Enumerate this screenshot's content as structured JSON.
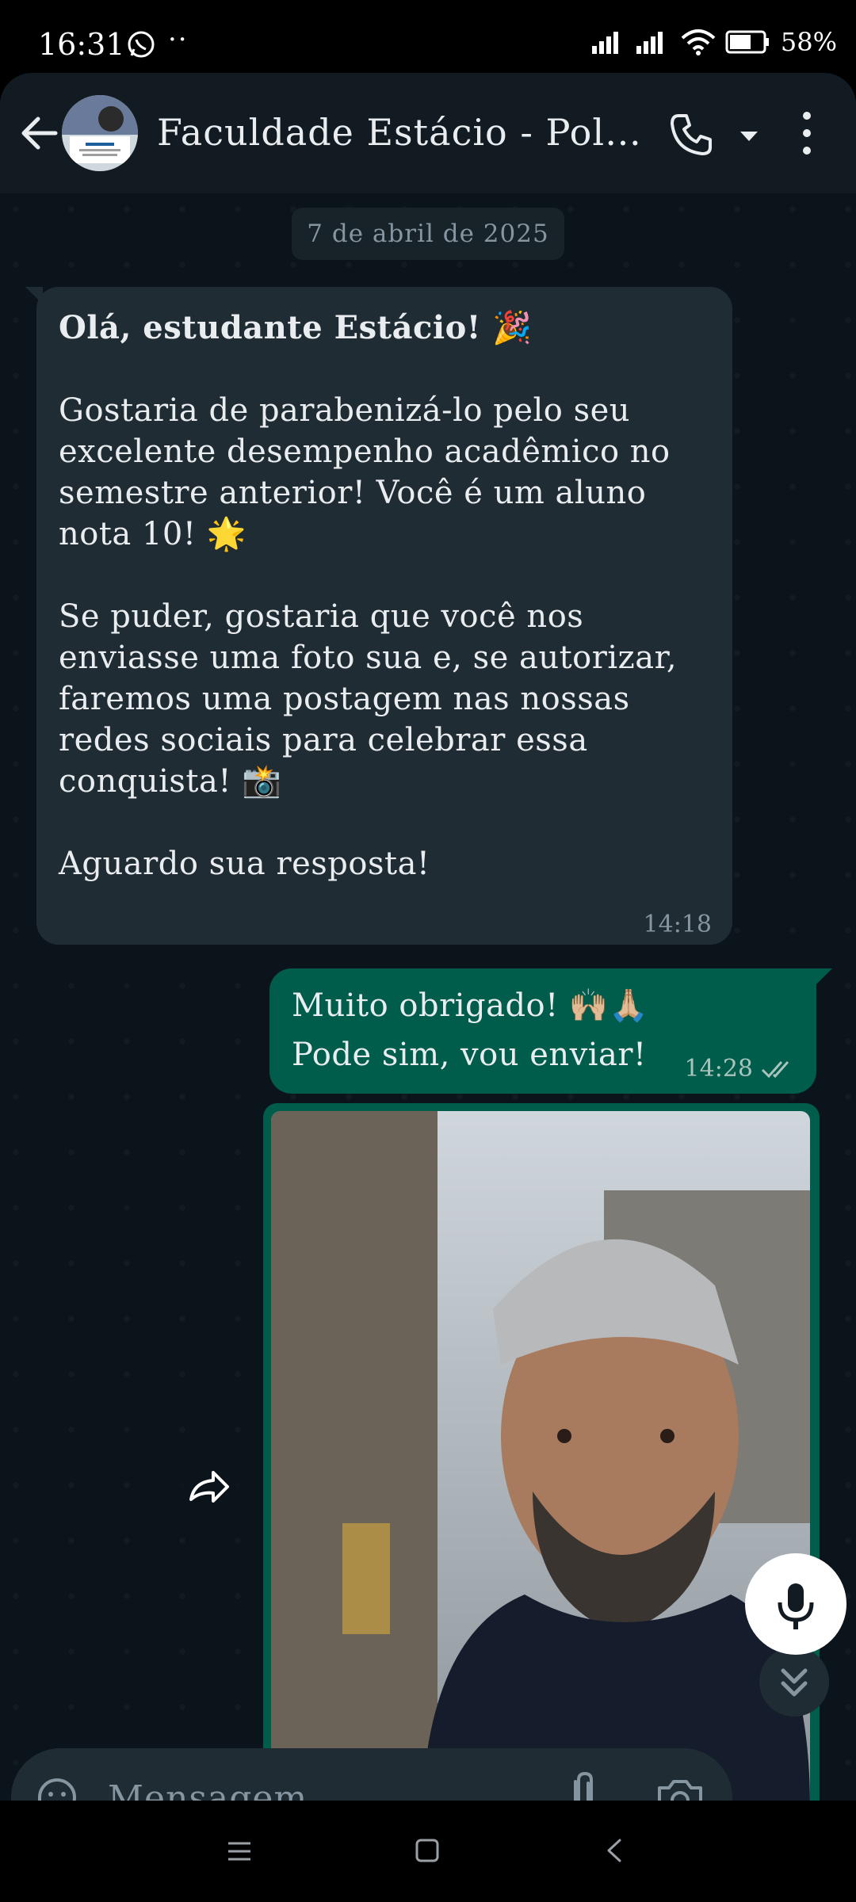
{
  "status_bar": {
    "time": "16:31",
    "battery": "58%"
  },
  "header": {
    "title": "Faculdade Estácio - Polo..."
  },
  "chat": {
    "date": "7 de abril de 2025",
    "incoming": {
      "greeting": "Olá, estudante Estácio! 🎉",
      "para1": "Gostaria de parabenizá-lo pelo seu excelente desempenho acadêmico no semestre anterior! Você é um aluno nota 10! 🌟",
      "para2": "Se puder, gostaria que você nos enviasse uma foto sua e, se autorizar, faremos uma postagem nas nossas redes sociais para celebrar essa conquista! 📸",
      "para3": "Aguardo sua resposta!",
      "time": "14:18"
    },
    "outgoing": {
      "line1": "Muito obrigado! 🙌🏼🙏🏼",
      "line2": "Pode sim, vou enviar!",
      "time": "14:28"
    }
  },
  "input": {
    "placeholder": "Mensagem"
  },
  "colors": {
    "header_bg": "#111b21",
    "chat_bg": "#0b141a",
    "incoming_bubble": "#202c33",
    "outgoing_bubble": "#005c4b",
    "read_tick": "#a8c4bd"
  },
  "icons": [
    "whatsapp-icon",
    "signal-icon",
    "wifi-icon",
    "battery-icon",
    "back-arrow-icon",
    "phone-icon",
    "chevron-down-icon",
    "more-vert-icon",
    "forward-icon",
    "double-chevron-down-icon",
    "sticker-icon",
    "attach-icon",
    "camera-icon",
    "mic-icon"
  ]
}
